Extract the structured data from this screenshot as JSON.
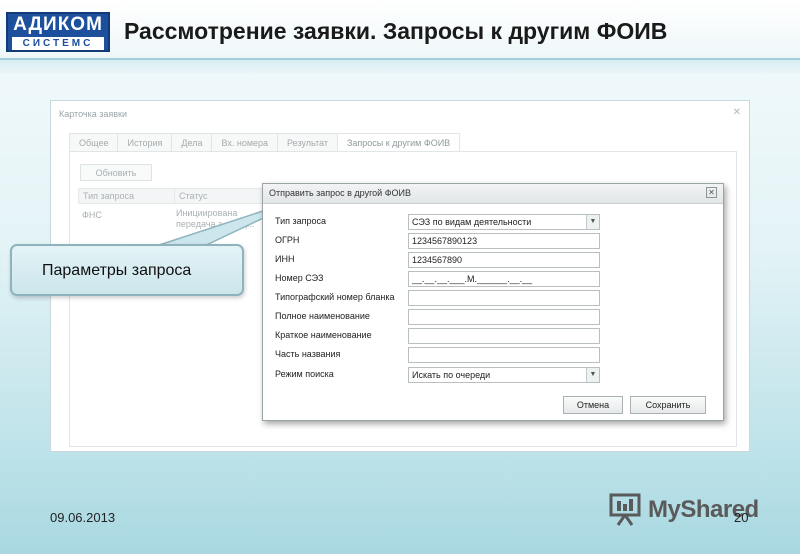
{
  "header": {
    "logo_top": "АДИКОМ",
    "logo_bottom": "СИСТЕМС",
    "title": "Рассмотрение заявки. Запросы к другим ФОИВ"
  },
  "card": {
    "title": "Карточка заявки",
    "tabs": [
      {
        "label": "Общее",
        "active": false
      },
      {
        "label": "История",
        "active": false
      },
      {
        "label": "Дела",
        "active": false
      },
      {
        "label": "Вх. номера",
        "active": false
      },
      {
        "label": "Результат",
        "active": false
      },
      {
        "label": "Запросы к другим ФОИВ",
        "active": true
      }
    ],
    "refresh_label": "Обновить",
    "grid": {
      "columns": [
        "Тип запроса",
        "Статус"
      ],
      "rows": [
        {
          "type": "ФНС",
          "status": "Инициирована передача з... вед..."
        }
      ]
    }
  },
  "dialog": {
    "title": "Отправить запрос в другой ФОИВ",
    "close_glyph": "✕",
    "fields": [
      {
        "label": "Тип запроса",
        "value": "СЭЗ по видам деятельности",
        "select": true
      },
      {
        "label": "ОГРН",
        "value": "1234567890123",
        "select": false
      },
      {
        "label": "ИНН",
        "value": "1234567890",
        "select": false
      },
      {
        "label": "Номер СЭЗ",
        "value": "__.__.__.___.М.______.__.__",
        "select": false
      },
      {
        "label": "Типографский номер бланка",
        "value": "",
        "select": false
      },
      {
        "label": "Полное наименование",
        "value": "",
        "select": false
      },
      {
        "label": "Краткое наименование",
        "value": "",
        "select": false
      },
      {
        "label": "Часть названия",
        "value": "",
        "select": false
      },
      {
        "label": "Режим поиска",
        "value": "Искать по очереди",
        "select": true
      }
    ],
    "cancel_label": "Отмена",
    "save_label": "Сохранить"
  },
  "callout": {
    "text": "Параметры запроса"
  },
  "footer": {
    "date": "09.06.2013",
    "watermark": "MyShared",
    "page_number": "20"
  },
  "icons": {
    "dialog_close": "close-icon",
    "select_arrow": "chevron-down-icon",
    "watermark": "presentation-board-icon"
  },
  "colors": {
    "logo_blue": "#1c4f9c",
    "header_border": "#9fd0da",
    "callout_border": "#8fb3bd"
  }
}
